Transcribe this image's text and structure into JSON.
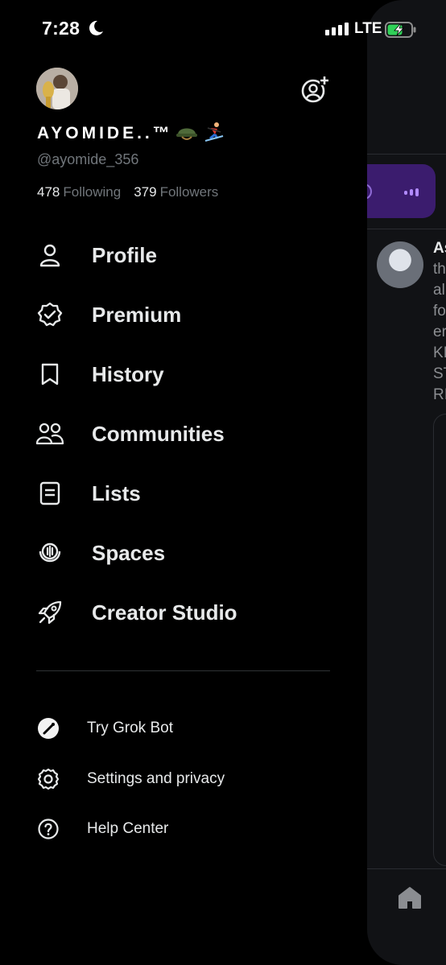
{
  "status_bar": {
    "time": "7:28",
    "network": "LTE"
  },
  "profile": {
    "display_name": "AYOMIDE..™",
    "handle": "@ayomide_356",
    "following_count": "478",
    "following_label": "Following",
    "followers_count": "379",
    "followers_label": "Followers"
  },
  "nav": {
    "items": [
      {
        "label": "Profile",
        "icon": "person-icon"
      },
      {
        "label": "Premium",
        "icon": "verified-badge-icon"
      },
      {
        "label": "History",
        "icon": "bookmark-icon"
      },
      {
        "label": "Communities",
        "icon": "people-icon"
      },
      {
        "label": "Lists",
        "icon": "list-icon"
      },
      {
        "label": "Spaces",
        "icon": "microphone-icon"
      },
      {
        "label": "Creator Studio",
        "icon": "rocket-icon"
      }
    ]
  },
  "secondary": {
    "items": [
      {
        "label": "Try Grok Bot",
        "icon": "grok-icon"
      },
      {
        "label": "Settings and privacy",
        "icon": "gear-icon"
      },
      {
        "label": "Help Center",
        "icon": "help-icon"
      }
    ]
  },
  "background_feed": {
    "line_1": "As",
    "lines": [
      "th",
      "al",
      "fo",
      "er",
      "KI",
      "ST",
      "RI"
    ]
  },
  "colors": {
    "background": "#000000",
    "text": "#e7e9ea",
    "muted": "#71767b",
    "spaces_accent": "#3b1c6e"
  }
}
